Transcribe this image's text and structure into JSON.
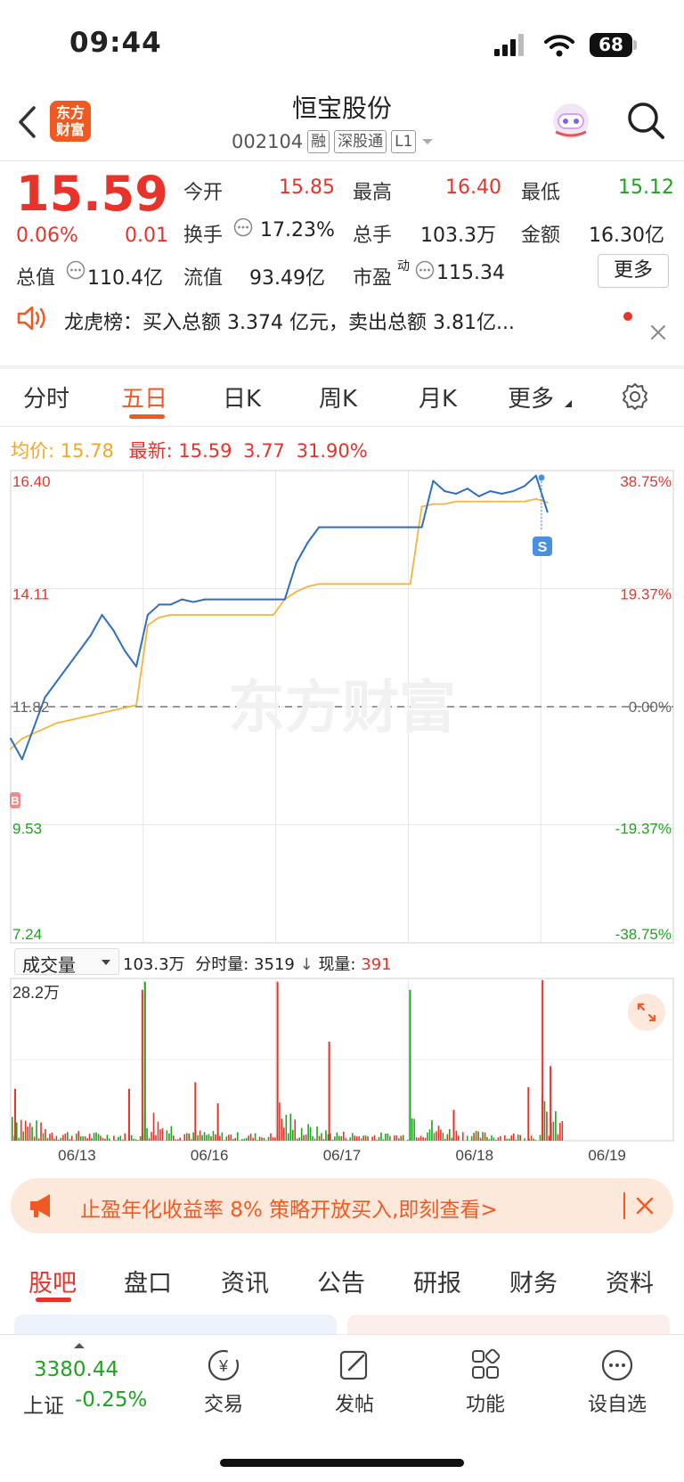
{
  "status_bar": {
    "time": "09:44",
    "battery": "68"
  },
  "header": {
    "logo_line1": "东方",
    "logo_line2": "财富",
    "stock_name": "恒宝股份",
    "stock_code": "002104",
    "tags": [
      "融",
      "深股通",
      "L1"
    ]
  },
  "quote": {
    "price": "15.59",
    "change_pct": "0.06%",
    "change": "0.01",
    "open_label": "今开",
    "open": "15.85",
    "high_label": "最高",
    "high": "16.40",
    "low_label": "最低",
    "low": "15.12",
    "turnover_label": "换手",
    "turnover": "17.23%",
    "volume_label": "总手",
    "volume": "103.3万",
    "amount_label": "金额",
    "amount": "16.30亿",
    "mcap_label": "总值",
    "mcap": "110.4亿",
    "float_label": "流值",
    "float": "93.49亿",
    "pe_label": "市盈",
    "pe_sup": "动",
    "pe": "115.34",
    "more_label": "更多"
  },
  "notice": {
    "text": "龙虎榜：买入总额 3.374 亿元，卖出总额 3.81亿..."
  },
  "chart_tabs": [
    "分时",
    "五日",
    "日K",
    "周K",
    "月K",
    "更多"
  ],
  "legend": {
    "avg_label": "均价:",
    "avg": "15.78",
    "latest_label": "最新:",
    "latest": "15.59",
    "latest_change": "3.77",
    "latest_pct": "31.90%"
  },
  "volume_bar": {
    "selector": "成交量",
    "total": "103.3万",
    "tick_label": "分时量: 3519",
    "current_label": "现量:",
    "current": "391",
    "max_label": "28.2万"
  },
  "chart_data": {
    "type": "line",
    "y_left_ticks": [
      "16.40",
      "14.11",
      "11.82",
      "9.53",
      "7.24"
    ],
    "y_right_ticks": [
      "38.75%",
      "19.37%",
      "0.00%",
      "-19.37%",
      "-38.75%"
    ],
    "ylim": [
      7.24,
      16.4
    ],
    "prev_close": 11.82,
    "x_labels": [
      "06/13",
      "06/16",
      "06/17",
      "06/18",
      "06/19"
    ],
    "series": [
      {
        "name": "price",
        "values": [
          11.2,
          10.8,
          11.4,
          12.0,
          12.3,
          12.6,
          12.9,
          13.2,
          13.6,
          13.3,
          12.9,
          12.6,
          13.6,
          13.8,
          13.8,
          13.9,
          13.85,
          13.9,
          13.9,
          13.9,
          13.9,
          13.9,
          13.9,
          13.9,
          13.9,
          14.6,
          15.0,
          15.3,
          15.3,
          15.3,
          15.3,
          15.3,
          15.3,
          15.3,
          15.3,
          15.3,
          15.3,
          16.2,
          16.0,
          15.95,
          16.05,
          15.9,
          16.0,
          15.95,
          16.0,
          16.1,
          16.3,
          15.6
        ]
      },
      {
        "name": "avg",
        "values": [
          11.0,
          11.2,
          11.3,
          11.4,
          11.5,
          11.55,
          11.6,
          11.65,
          11.7,
          11.75,
          11.8,
          11.85,
          13.4,
          13.55,
          13.6,
          13.6,
          13.6,
          13.6,
          13.6,
          13.6,
          13.6,
          13.6,
          13.6,
          13.6,
          13.9,
          14.05,
          14.15,
          14.2,
          14.2,
          14.2,
          14.2,
          14.2,
          14.2,
          14.2,
          14.2,
          14.2,
          15.7,
          15.75,
          15.75,
          15.8,
          15.8,
          15.8,
          15.8,
          15.8,
          15.8,
          15.8,
          15.85,
          15.78
        ]
      }
    ]
  },
  "banner": {
    "text": "止盈年化收益率 8% 策略开放买入,即刻查看>"
  },
  "bottom_tabs": [
    "股吧",
    "盘口",
    "资讯",
    "公告",
    "研报",
    "财务",
    "资料"
  ],
  "nav": {
    "index_value": "3380.44",
    "index_name": "上证",
    "index_change": "-0.25%",
    "items": [
      "交易",
      "发帖",
      "功能",
      "设自选"
    ]
  },
  "watermark": "东方财富",
  "colors": {
    "up": "#e8332b",
    "down": "#1ea51e",
    "accent": "#f05a22",
    "price_line": "#2f6fbf",
    "avg_line": "#f5b43c"
  }
}
